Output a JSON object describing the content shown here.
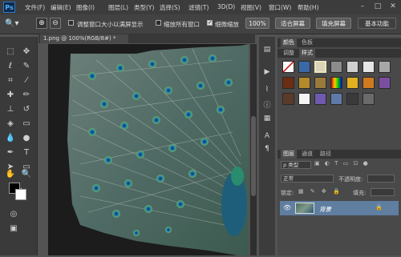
{
  "app": {
    "logo": "Ps"
  },
  "menu": [
    "文件(F)",
    "编辑(E)",
    "图像(I)",
    "图层(L)",
    "类型(Y)",
    "选择(S)",
    "滤镜(T)",
    "3D(D)",
    "视图(V)",
    "窗口(W)",
    "帮助(H)"
  ],
  "window": {
    "minimize": "–",
    "maximize": "□",
    "close": "✕"
  },
  "options": {
    "check1_label": "调整窗口大小以满屏显示",
    "check2_label": "缩放所有窗口",
    "check3_label": "细微缩放",
    "btn_100": "100%",
    "btn_fit": "适合屏幕",
    "btn_fill": "填充屏幕",
    "essentials": "基本功能"
  },
  "document": {
    "tab_title": "1.png @ 100%(RGB/8#) *"
  },
  "panels": {
    "top_tabs": [
      "颜色",
      "色板"
    ],
    "second_tabs": [
      "调整",
      "样式"
    ],
    "layer_tabs": [
      "图层",
      "通道",
      "路径"
    ],
    "kind_label": "ρ 类型",
    "blend_mode": "正常",
    "opacity_label": "不透明度:",
    "lock_label": "锁定:",
    "fill_label": "填充:",
    "layer_name": "背景"
  },
  "colors": {
    "accent": "#2e79c7",
    "selected_layer": "#5f7ea0"
  }
}
